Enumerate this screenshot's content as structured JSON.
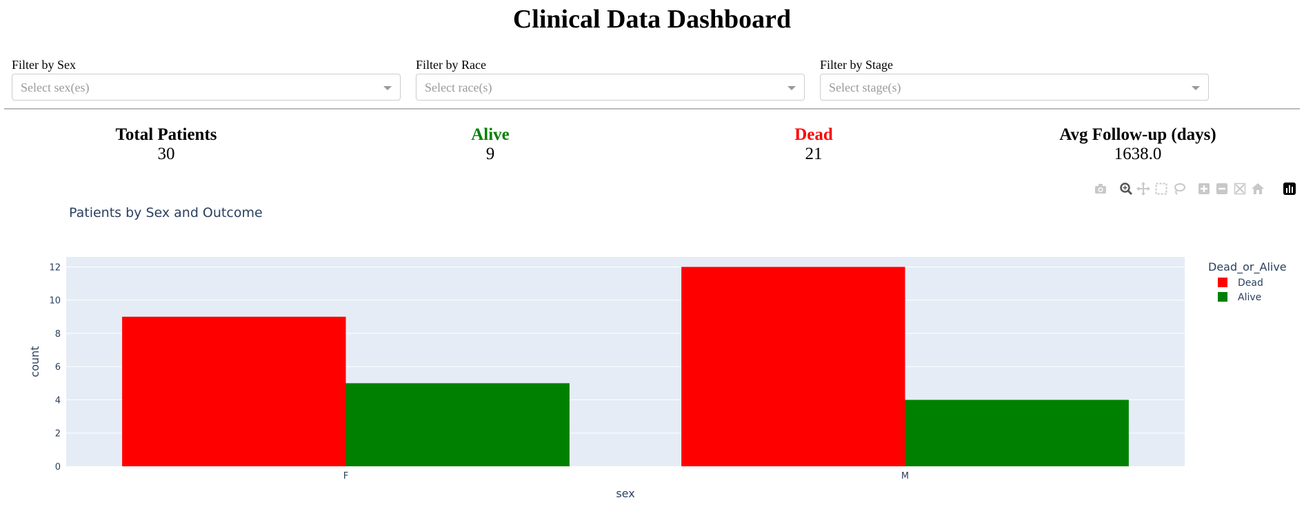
{
  "page": {
    "title": "Clinical Data Dashboard"
  },
  "filters": [
    {
      "label": "Filter by Sex",
      "placeholder": "Select sex(es)"
    },
    {
      "label": "Filter by Race",
      "placeholder": "Select race(s)"
    },
    {
      "label": "Filter by Stage",
      "placeholder": "Select stage(s)"
    }
  ],
  "kpis": [
    {
      "label": "Total Patients",
      "value": "30",
      "color": "#000000"
    },
    {
      "label": "Alive",
      "value": "9",
      "color": "#008000"
    },
    {
      "label": "Dead",
      "value": "21",
      "color": "#ff0000"
    },
    {
      "label": "Avg Follow-up (days)",
      "value": "1638.0",
      "color": "#000000"
    }
  ],
  "modebar": {
    "icons": [
      "camera-icon",
      "zoom-icon",
      "pan-icon",
      "box-select-icon",
      "lasso-select-icon",
      "zoom-in-icon",
      "zoom-out-icon",
      "autoscale-icon",
      "reset-axes-icon",
      "plotly-logo-icon"
    ]
  },
  "chart_data": {
    "type": "bar",
    "title": "Patients by Sex and Outcome",
    "xlabel": "sex",
    "ylabel": "count",
    "categories": [
      "F",
      "M"
    ],
    "series": [
      {
        "name": "Dead",
        "values": [
          9,
          12
        ],
        "color": "#ff0000"
      },
      {
        "name": "Alive",
        "values": [
          5,
          4
        ],
        "color": "#008000"
      }
    ],
    "legend_title": "Dead_or_Alive",
    "legend_position": "right",
    "ylim": [
      0,
      12.6
    ],
    "yticks": [
      0,
      2,
      4,
      6,
      8,
      10,
      12
    ],
    "grid": true,
    "plot_bgcolor": "#e5ecf6"
  }
}
